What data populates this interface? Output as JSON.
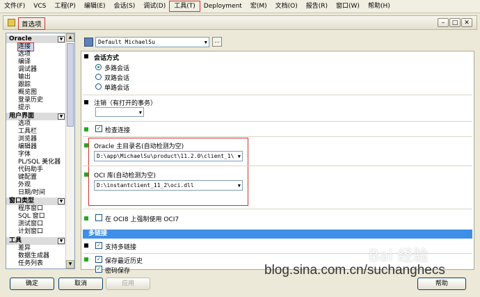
{
  "menubar": [
    "文件(F)",
    "VCS",
    "工程(P)",
    "编辑(E)",
    "会话(S)",
    "调试(D)",
    "工具(T)",
    "Deployment",
    "宏(M)",
    "文档(O)",
    "报告(R)",
    "窗口(W)",
    "帮助(H)"
  ],
  "window": {
    "title": "首选项"
  },
  "tree": {
    "groups": [
      {
        "label": "Oracle",
        "items": [
          "连接",
          "选项",
          "编译",
          "调试器",
          "输出",
          "跟踪",
          "概览图",
          "登录历史",
          "提示"
        ]
      },
      {
        "label": "用户界面",
        "items": [
          "选项",
          "工具栏",
          "浏览器",
          "编辑器",
          "字体",
          "PL/SQL 美化器",
          "代码助手",
          "键配置",
          "外观",
          "日期/时间"
        ]
      },
      {
        "label": "窗口类型",
        "items": [
          "程序窗口",
          "SQL 窗口",
          "测试窗口",
          "计划窗口"
        ]
      },
      {
        "label": "工具",
        "items": [
          "差异",
          "数据生成器",
          "任务列表"
        ]
      }
    ],
    "selected": "连接"
  },
  "profile": {
    "value": "Default MichaelSu",
    "more_label": "..."
  },
  "session_mode": {
    "title": "会话方式",
    "options": [
      "多路会话",
      "双路会话",
      "单路会话"
    ],
    "selected": 0
  },
  "logoff": {
    "title": "注销（有打开的事务）",
    "value": ""
  },
  "check_connection": {
    "label": "检查连接",
    "checked": true
  },
  "oracle_home": {
    "label": "Oracle 主目录名(自动检测为空)",
    "value": "D:\\app\\MichaelSu\\product\\11.2.0\\client_1\\"
  },
  "oci_library": {
    "label": "OCI 库(自动检测为空)",
    "value": "D:\\instantclient_11_2\\oci.dll"
  },
  "oci8_force": {
    "label": "在 OCI8 上强制使用 OCI7",
    "checked": false
  },
  "multi_connection": {
    "header": "多链接",
    "support": {
      "label": "支持多链接",
      "checked": true
    },
    "save_history": {
      "label": "保存最近历史",
      "checked": true
    },
    "save_password": {
      "label": "密码保存",
      "checked": true
    }
  },
  "buttons": {
    "ok": "确定",
    "cancel": "取消",
    "apply": "应用",
    "help": "帮助"
  },
  "watermarks": {
    "baidu": "Bai 经验",
    "blog": "blog.sina.com.cn/suchanghecs"
  },
  "colors": {
    "accent_bar": "#3f8fe8",
    "annotation": "#d0302b",
    "marker_green": "#22aa22"
  }
}
